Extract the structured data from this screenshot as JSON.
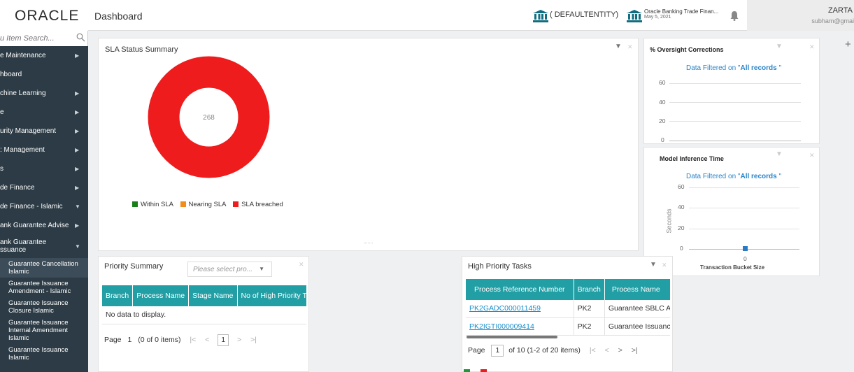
{
  "header": {
    "logo": "ORACLE",
    "page_title": "Dashboard",
    "entity1": "( DEFAULTENTITY)",
    "entity2_name": "Oracle Banking Trade Finan...",
    "entity2_date": "May 5, 2021",
    "user_name": "ZARTA",
    "user_email": "subham@gmai"
  },
  "sidebar": {
    "search_placeholder": "u Item Search...",
    "items": [
      {
        "label": "e Maintenance"
      },
      {
        "label": "hboard"
      },
      {
        "label": "chine Learning"
      },
      {
        "label": "e"
      },
      {
        "label": "urity Management"
      },
      {
        "label": ": Management"
      },
      {
        "label": "s"
      },
      {
        "label": "de Finance"
      },
      {
        "label": "de Finance - Islamic"
      },
      {
        "label": "ank Guarantee Advise"
      },
      {
        "label": "ank Guarantee\nssuance"
      }
    ],
    "sub_items": [
      {
        "label": "Guarantee Cancellation Islamic"
      },
      {
        "label": "Guarantee Issuance Amendment - Islamic"
      },
      {
        "label": "Guarantee Issuance Closure Islamic"
      },
      {
        "label": "Guarantee Issuance Internal Amendment Islamic"
      },
      {
        "label": "Guarantee Issuance Islamic"
      }
    ]
  },
  "sla": {
    "title": "SLA Status Summary",
    "center_value": "268",
    "legend": [
      {
        "label": "Within SLA",
        "color": "#1a7f1a"
      },
      {
        "label": "Nearing SLA",
        "color": "#f28c1a"
      },
      {
        "label": "SLA breached",
        "color": "#ee1c1c"
      }
    ]
  },
  "oversight": {
    "title": "% Oversight Corrections",
    "filter_prefix": "Data Filtered on \"",
    "filter_value": "All records",
    "filter_suffix": " \"",
    "y_ticks": [
      "60",
      "40",
      "20",
      "0"
    ]
  },
  "model": {
    "title": "Model Inference Time",
    "filter_prefix": "Data Filtered on \"",
    "filter_value": "All records",
    "filter_suffix": " \"",
    "y_ticks": [
      "60",
      "40",
      "20",
      "0"
    ],
    "y_label": "Seconds",
    "x_tick": "0",
    "x_label": "Transaction Bucket Size",
    "point_value": 0
  },
  "priority": {
    "title": "Priority Summary",
    "dropdown_placeholder": "Please select pro...",
    "columns": [
      "Branch",
      "Process Name",
      "Stage Name",
      "No of High Priority T"
    ],
    "empty": "No data to display.",
    "pager": {
      "label": "Page",
      "current": "1",
      "info": "(0 of 0 items)",
      "box": "1"
    }
  },
  "tasks": {
    "title": "High Priority Tasks",
    "columns": [
      "Process Reference Number",
      "Branch",
      "Process Name"
    ],
    "rows": [
      [
        "PK2GADC000011459",
        "PK2",
        "Guarantee SBLC Adv"
      ],
      [
        "PK2IGTI000009414",
        "PK2",
        "Guarantee Issuance"
      ]
    ],
    "pager": {
      "label": "Page",
      "box": "1",
      "info": "of 10  (1-2 of 20 items)"
    }
  },
  "colors": {
    "sidebar_bg": "#2c3b45",
    "table_header": "#229fa5",
    "donut_red": "#ee1c1c",
    "link_blue": "#1a8ec9"
  }
}
